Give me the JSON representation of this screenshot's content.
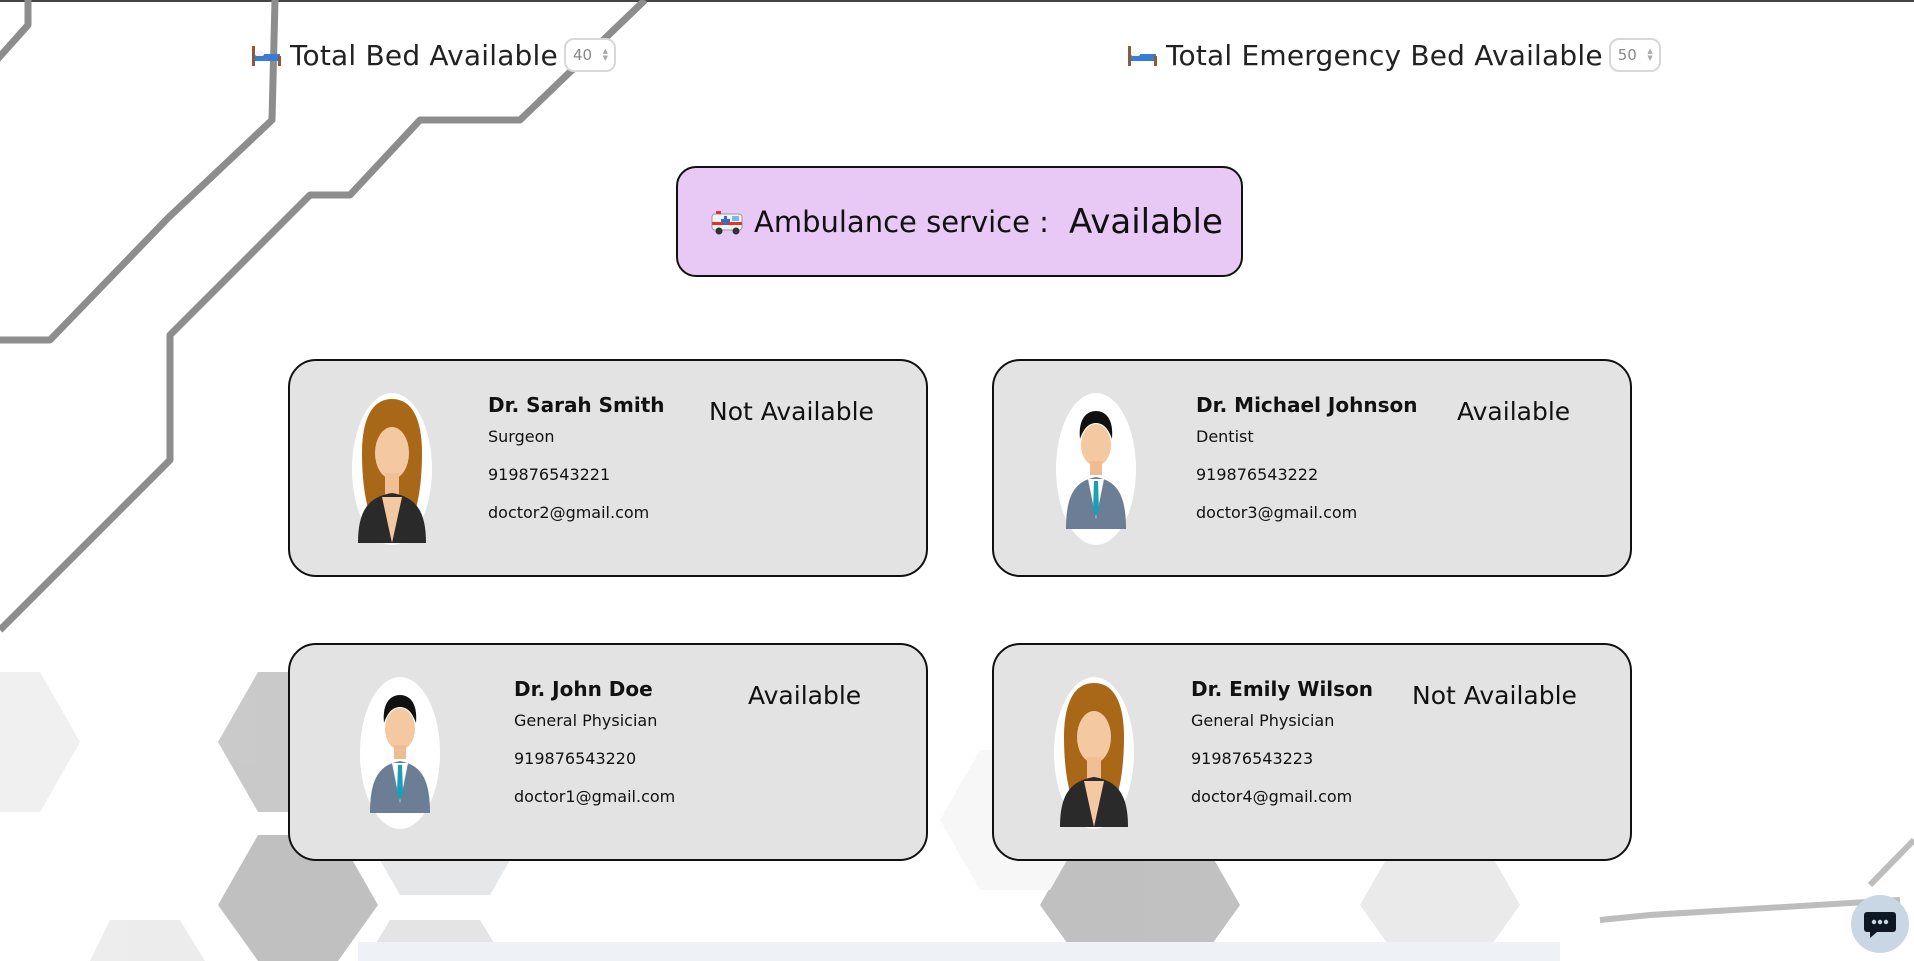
{
  "beds": {
    "total_label": "Total Bed Available",
    "total_value": "40",
    "emergency_label": "Total Emergency Bed Available",
    "emergency_value": "50"
  },
  "ambulance": {
    "label": "Ambulance service :",
    "status": "Available"
  },
  "doctors": [
    {
      "name": "Dr. Sarah Smith",
      "specialty": "Surgeon",
      "phone": "919876543221",
      "email": "doctor2@gmail.com",
      "status": "Not Available",
      "avatar": "female-doctor-avatar"
    },
    {
      "name": "Dr. Michael Johnson",
      "specialty": "Dentist",
      "phone": "919876543222",
      "email": "doctor3@gmail.com",
      "status": "Available",
      "avatar": "male-doctor-avatar"
    },
    {
      "name": "Dr. John Doe",
      "specialty": "General Physician",
      "phone": "919876543220",
      "email": "doctor1@gmail.com",
      "status": "Available",
      "avatar": "male-doctor-avatar"
    },
    {
      "name": "Dr. Emily Wilson",
      "specialty": "General Physician",
      "phone": "919876543223",
      "email": "doctor4@gmail.com",
      "status": "Not Available",
      "avatar": "female-doctor-avatar"
    }
  ],
  "icons": {
    "bed": "bed-icon",
    "ambulance": "ambulance-icon",
    "chat": "chat-icon"
  },
  "colors": {
    "ambulance_bg": "#e8c9f5",
    "card_bg": "#e3e3e3",
    "chat_button": "#c9d6e3"
  }
}
